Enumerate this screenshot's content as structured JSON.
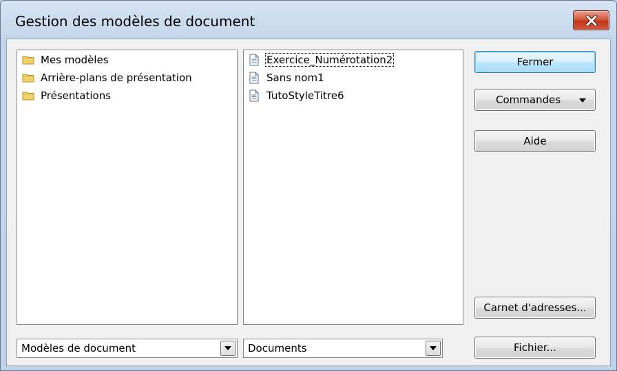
{
  "window": {
    "title": "Gestion des modèles de document"
  },
  "categories": {
    "items": [
      {
        "label": "Mes modèles",
        "icon": "folder-icon"
      },
      {
        "label": "Arrière-plans de présentation",
        "icon": "folder-icon"
      },
      {
        "label": "Présentations",
        "icon": "folder-icon"
      }
    ]
  },
  "documents": {
    "items": [
      {
        "label": "Exercice_Numérotation2",
        "icon": "document-icon",
        "focused": true
      },
      {
        "label": "Sans nom1",
        "icon": "document-icon"
      },
      {
        "label": "TutoStyleTitre6",
        "icon": "document-icon"
      }
    ]
  },
  "buttons": {
    "close": "Fermer",
    "commands": "Commandes",
    "help": "Aide",
    "address_book": "Carnet d'adresses...",
    "file": "Fichier..."
  },
  "combos": {
    "left_value": "Modèles de document",
    "right_value": "Documents"
  },
  "colors": {
    "close_button": "#c2361b",
    "folder": "#f2d26b",
    "default_button_border": "#3c7fb1"
  }
}
